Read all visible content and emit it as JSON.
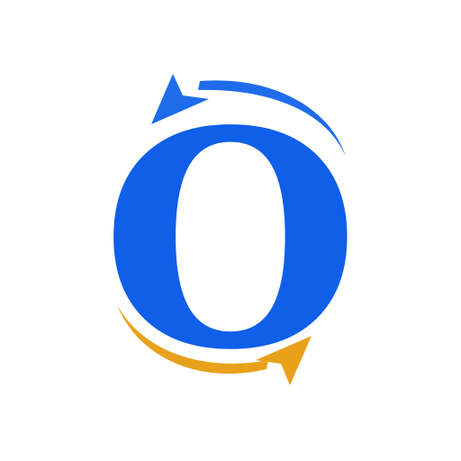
{
  "logo": {
    "letter": "O",
    "colors": {
      "letter": "#0F5FE8",
      "top_arrow": "#1E6CEB",
      "bottom_arrow": "#E9A11C",
      "background": "#FFFFFF"
    },
    "icons": [
      "counterclockwise-arrow-icon",
      "clockwise-arrow-icon"
    ]
  }
}
